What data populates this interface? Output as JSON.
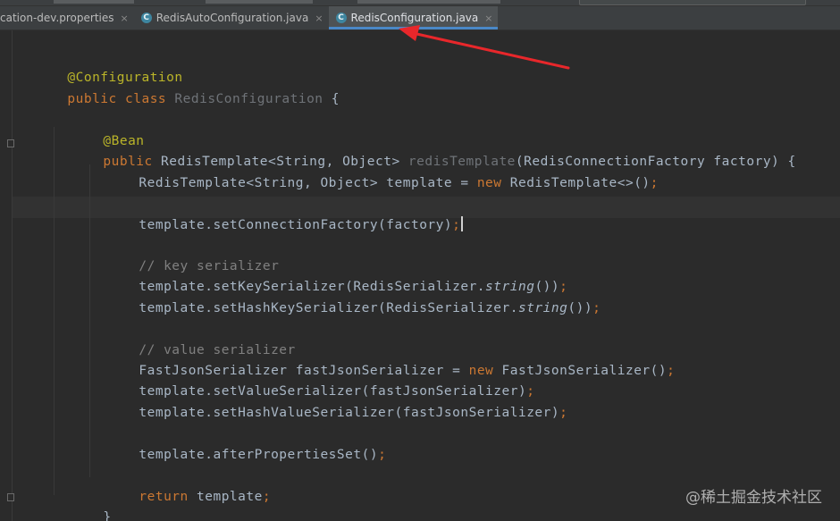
{
  "tabs": [
    {
      "label": "cation-dev.properties",
      "icon": "none",
      "active": false
    },
    {
      "label": "RedisAutoConfiguration.java",
      "icon": "java-class-icon",
      "active": false
    },
    {
      "label": "RedisConfiguration.java",
      "icon": "java-class-icon",
      "active": true
    }
  ],
  "tab_icon_glyph": "C",
  "close_glyph": "×",
  "code": {
    "l1": {
      "a": "@Configuration"
    },
    "l2": {
      "k1": "public",
      "k2": "class",
      "name": "RedisConfiguration",
      "brace": "{"
    },
    "l4": {
      "a": "@Bean"
    },
    "l5": {
      "k1": "public",
      "type": "RedisTemplate<String, Object>",
      "method": "redisTemplate",
      "params": "(RedisConnectionFactory factory) {"
    },
    "l6": {
      "pre": "RedisTemplate<String, Object> template = ",
      "kw": "new",
      "post": " RedisTemplate<>()",
      "semi": ";"
    },
    "l8": {
      "text": "template.setConnectionFactory(factory)",
      "semi": ";"
    },
    "l10": {
      "c": "// key serializer"
    },
    "l11": {
      "pre": "template.setKeySerializer(RedisSerializer.",
      "it": "string",
      "post": "())",
      "semi": ";"
    },
    "l12": {
      "pre": "template.setHashKeySerializer(RedisSerializer.",
      "it": "string",
      "post": "())",
      "semi": ";"
    },
    "l14": {
      "c": "// value serializer"
    },
    "l15": {
      "pre": "FastJsonSerializer fastJsonSerializer = ",
      "kw": "new",
      "post": " FastJsonSerializer()",
      "semi": ";"
    },
    "l16": {
      "text": "template.setValueSerializer(fastJsonSerializer)",
      "semi": ";"
    },
    "l17": {
      "text": "template.setHashValueSerializer(fastJsonSerializer)",
      "semi": ";"
    },
    "l19": {
      "text": "template.afterPropertiesSet()",
      "semi": ";"
    },
    "l21": {
      "kw": "return",
      "text": " template",
      "semi": ";"
    },
    "l22": {
      "brace": "}"
    }
  },
  "colors": {
    "keyword": "#cc7832",
    "annotation": "#bbb529",
    "comment": "#808080",
    "method_decl": "#ffc66d",
    "plain": "#a9b7c6",
    "arrow": "#e8272b",
    "active_tab_underline": "#4a88c7"
  },
  "watermark": "@稀土掘金技术社区"
}
